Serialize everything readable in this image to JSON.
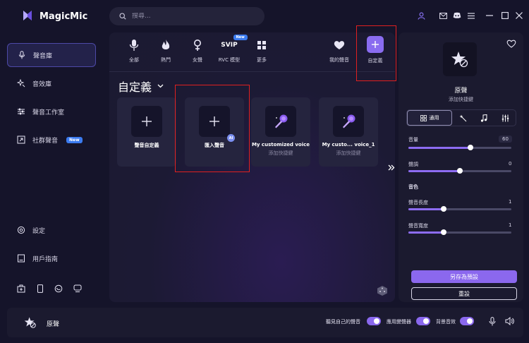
{
  "app": {
    "title": "MagicMic"
  },
  "search": {
    "placeholder": "搜尋..."
  },
  "sidebar": {
    "items": [
      {
        "label": "聲音庫",
        "icon": "mic-icon"
      },
      {
        "label": "音效庫",
        "icon": "sparkle-icon"
      },
      {
        "label": "聲音工作室",
        "icon": "sliders-icon"
      },
      {
        "label": "社群聲音",
        "icon": "share-icon",
        "badge": "New"
      }
    ],
    "settings_label": "設定",
    "guide_label": "用戶指南"
  },
  "tabs": [
    {
      "label": "全部"
    },
    {
      "label": "熱門"
    },
    {
      "label": "女聲"
    },
    {
      "label": "RVC 模型",
      "icon_text": "SVIP",
      "badge": "New"
    },
    {
      "label": "更多"
    },
    {
      "label": "我的聲音"
    },
    {
      "label": "自定義"
    }
  ],
  "section": {
    "title": "自定義"
  },
  "cards": [
    {
      "title": "聲音自定義",
      "sub": ""
    },
    {
      "title": "匯入聲音",
      "sub": "",
      "ai_badge": "AI"
    },
    {
      "title": "My customized voice",
      "sub": "添加快捷鍵"
    },
    {
      "title": "My custo... voice_1",
      "sub": "添加快捷鍵"
    }
  ],
  "right": {
    "voice_name": "原聲",
    "voice_sub": "添加快捷鍵",
    "seg_general": "通用",
    "volume_label": "音量",
    "volume_value": "60",
    "volume": 60,
    "pitch_label": "聲調",
    "pitch_value": "0",
    "timbre_label": "音色",
    "length_label": "聲音長度",
    "length_value": "1",
    "width_label": "聲音寬度",
    "width_value": "1",
    "save_preset": "另存為預設",
    "reset": "重設"
  },
  "bottom": {
    "name": "原聲",
    "hear_self": "聽見自己的聲音",
    "voice_changer": "應用變聲器",
    "bg_sound": "背景音效"
  },
  "colors": {
    "accent": "#8a68ee",
    "bg": "#15142a",
    "panel": "#1b1a2f"
  }
}
